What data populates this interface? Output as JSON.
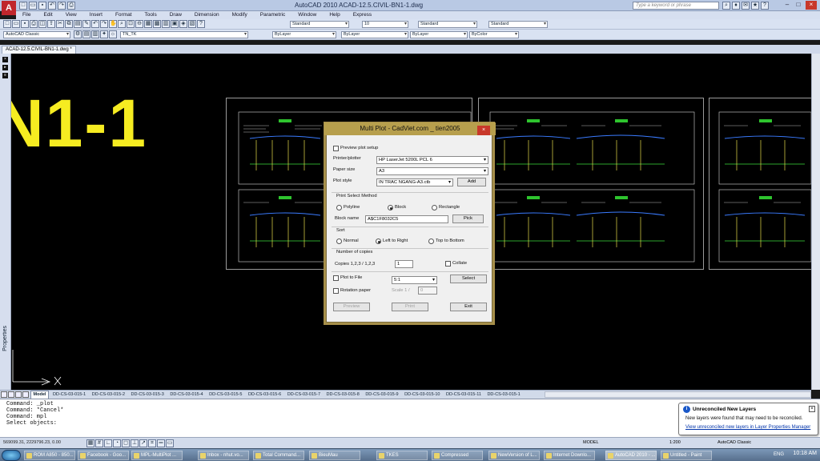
{
  "window": {
    "title": "AutoCAD 2010     ACAD-12.5.CIVIL-BN1-1.dwg",
    "search_placeholder": "Type a keyword or phrase"
  },
  "menu": [
    "File",
    "Edit",
    "View",
    "Insert",
    "Format",
    "Tools",
    "Draw",
    "Dimension",
    "Modify",
    "Parametric",
    "Window",
    "Help",
    "Express"
  ],
  "toolbar": {
    "workspace": "AutoCAD Classic",
    "text_style": "Standard",
    "text_height": "10",
    "dim_style": "Standard",
    "table_style": "Standard",
    "layer": "TN_TK",
    "color": "ByLayer",
    "linetype": "ByLayer",
    "lineweight": "ByLayer",
    "plotstyle": "ByColor"
  },
  "document_tab": "ACAD-12.5.CIVIL-BN1-1.dwg *",
  "drawing": {
    "big_label": "N1-1"
  },
  "sidebar": {
    "properties_label": "Properties"
  },
  "layout_tabs": {
    "model": "Model",
    "layouts": [
      "DD-CS-03-015-1",
      "DD-CS-03-015-2",
      "DD-CS-03-015-3",
      "DD-CS-03-015-4",
      "DD-CS-03-015-5",
      "DD-CS-03-015-6",
      "DD-CS-03-015-7",
      "DD-CS-03-015-8",
      "DD-CS-03-015-9",
      "DD-CS-03-015-10",
      "DD-CS-03-015-11",
      "DD-CS-03-015-1"
    ]
  },
  "command_history": [
    "Command: _plot",
    "Command: *Cancel*",
    "Command: mpl",
    "Select objects:"
  ],
  "status": {
    "coords": "569099.31, 2229796.23, 0.00",
    "model": "MODEL",
    "scale": "1:200",
    "workspace": "AutoCAD Classic"
  },
  "balloon": {
    "title": "Unreconciled New Layers",
    "body": "New layers were found that may need to be reconciled.",
    "link": "View unreconciled new layers in Layer Properties Manager"
  },
  "dialog": {
    "title": "Multi Plot - CadViet.com _ tien2005",
    "close": "×",
    "preview_setup": "Preview plot setup",
    "printer_label": "Printer/plotter",
    "printer_value": "HP LaserJet 5200L PCL 6",
    "paper_label": "Paper size",
    "paper_value": "A3",
    "style_label": "Plot style",
    "style_value": "IN TRAC NGANG-A3.ctb",
    "add": "Add",
    "select_method_title": "Print Select Method",
    "opt_polyline": "Polyline",
    "opt_block": "Block",
    "opt_rectangle": "Rectangle",
    "block_label": "Block name",
    "block_value": "A$C1F8032C5",
    "pick": "Pick",
    "sort_title": "Sort",
    "sort_normal": "Normal",
    "sort_ltr": "Left to Right",
    "sort_ttb": "Top to Bottom",
    "copies_title": "Number of copies",
    "copies_label": "Copies 1,2,3 / 1,2,3",
    "copies_value": "1",
    "collate": "Collate",
    "plot_to_file": "Plot to File",
    "ratio_value": "5:1",
    "select": "Select",
    "rotation": "Rotation paper",
    "scale_label": "Scale 1 /",
    "scale_value": "0",
    "preview": "Preview",
    "print": "Print",
    "exit": "Exit"
  },
  "taskbar": {
    "items": [
      "ROM A850 - 850...",
      "Facebook - Goo...",
      "MPL-MultiPlot ...",
      "Inbox - nhut.vo...",
      "Total Command...",
      "BieuMau",
      "TKES",
      "Compressed",
      "NewVersion of L...",
      "Internet Downlo...",
      "AutoCAD 2010 - ...",
      "Untitled - Paint"
    ],
    "lang": "ENG",
    "time": "10:18 AM"
  }
}
